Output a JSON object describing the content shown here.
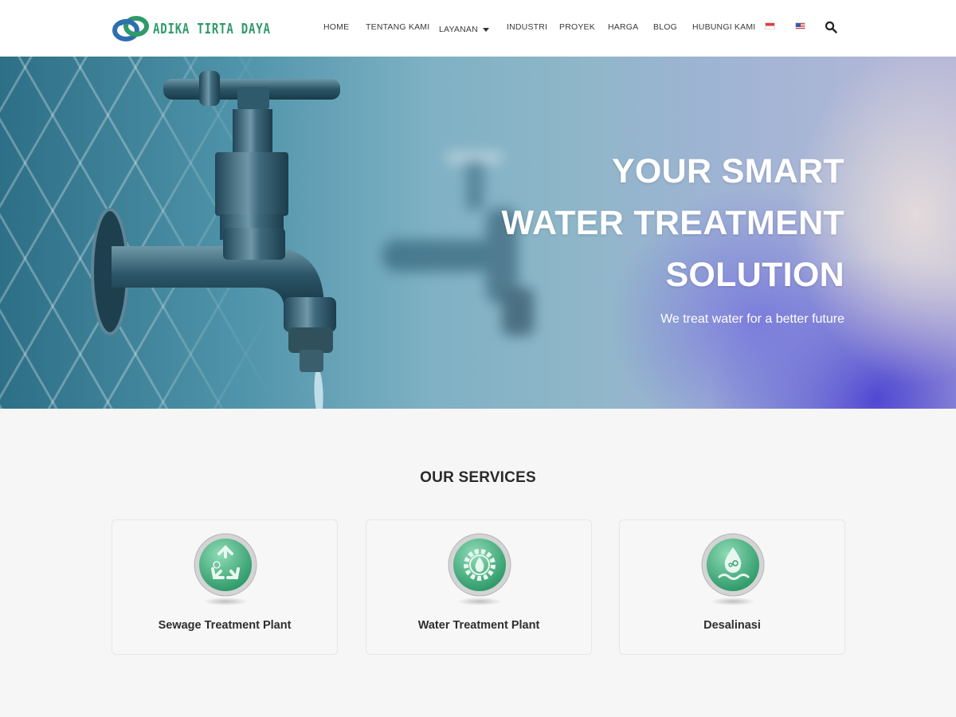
{
  "header": {
    "brand": "ADIKA TIRTA DAYA",
    "nav": [
      {
        "label": "HOME"
      },
      {
        "label": "TENTANG KAMI"
      },
      {
        "label": "LAYANAN"
      },
      {
        "label": "INDUSTRI"
      },
      {
        "label": "PROYEK"
      },
      {
        "label": "HARGA"
      },
      {
        "label": "BLOG"
      },
      {
        "label": "HUBUNGI KAMI"
      }
    ],
    "icons": [
      "indonesia-flag-icon",
      "us-flag-icon",
      "search-icon"
    ]
  },
  "hero": {
    "title_lines": [
      "YOUR SMART",
      "WATER TREATMENT",
      "SOLUTION"
    ],
    "subtitle": "We treat water for a better future"
  },
  "services": {
    "title": "OUR SERVICES",
    "items": [
      {
        "label": "Sewage Treatment Plant",
        "icon": "recycle-icon"
      },
      {
        "label": "Water Treatment Plant",
        "icon": "gear-drop-icon"
      },
      {
        "label": "Desalinasi",
        "icon": "drop-wave-icon"
      }
    ]
  },
  "colors": {
    "brand_green": "#2f9a6a",
    "brand_blue": "#2f6fb0",
    "icon_green": "#3faa7a",
    "background": "#f6f6f7",
    "header_bg": "#ffffff"
  }
}
